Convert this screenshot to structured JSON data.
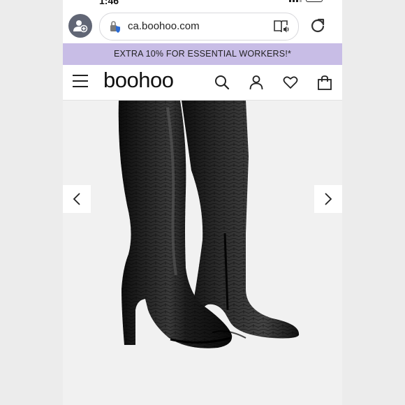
{
  "status": {
    "time": "1:46"
  },
  "browser": {
    "url": "ca.boohoo.com"
  },
  "promo": {
    "text": "EXTRA 10% FOR ESSENTIAL WORKERS!*"
  },
  "header": {
    "logo": "boohoo"
  },
  "icons": {
    "profile": "profile-add-icon",
    "lock": "site-info-icon",
    "reader": "reader-view-icon",
    "reload": "reload-icon",
    "menu": "hamburger-menu-icon",
    "search": "search-icon",
    "account": "account-icon",
    "wishlist": "heart-icon",
    "bag": "shopping-bag-icon",
    "prev": "chevron-left-icon",
    "next": "chevron-right-icon"
  },
  "product": {
    "image_alt": "black croc knee high block heel boots"
  },
  "colors": {
    "promo_bg": "#c8bde6",
    "boot": "#1a1a1a"
  }
}
